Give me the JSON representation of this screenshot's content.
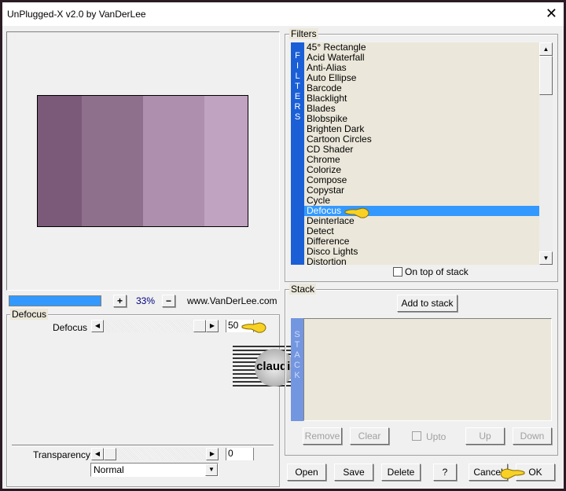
{
  "window": {
    "title": "UnPlugged-X v2.0 by VanDerLee",
    "close_icon": "close-icon"
  },
  "preview": {
    "swatch_colors": [
      "#7a5a78",
      "#8f708c",
      "#ae8fae",
      "#c0a2c1"
    ],
    "zoom_value": "33%",
    "zoom_in": "+",
    "zoom_out": "−",
    "progress_percent": 100,
    "website": "www.VanDerLee.com"
  },
  "filters": {
    "label": "Filters",
    "side_label": [
      "F",
      "I",
      "L",
      "T",
      "E",
      "R",
      "S"
    ],
    "items": [
      "45° Rectangle",
      "Acid Waterfall",
      "Anti-Alias",
      "Auto Ellipse",
      "Barcode",
      "Blacklight",
      "Blades",
      "Blobspike",
      "Brighten Dark",
      "Cartoon Circles",
      "CD Shader",
      "Chrome",
      "Colorize",
      "Compose",
      "Copystar",
      "Cycle",
      "Defocus",
      "Deinterlace",
      "Detect",
      "Difference",
      "Disco Lights",
      "Distortion"
    ],
    "selected": "Defocus",
    "on_top_label": "On top of stack",
    "on_top_checked": false
  },
  "params": {
    "group_label": "Defocus",
    "slider_label": "Defocus",
    "slider_value": "50",
    "slider_fraction": 0.5,
    "transparency_label": "Transparency",
    "transparency_value": "0",
    "blend_mode": "Normal"
  },
  "stack": {
    "label": "Stack",
    "add_label": "Add to stack",
    "side_label": [
      "S",
      "T",
      "A",
      "C",
      "K"
    ],
    "remove": "Remove",
    "clear": "Clear",
    "upto": "Upto",
    "up": "Up",
    "down": "Down"
  },
  "footer": {
    "open": "Open",
    "save": "Save",
    "delete": "Delete",
    "help": "?",
    "cancel": "Cancel",
    "ok": "OK"
  },
  "watermark": {
    "text": "claudia"
  }
}
